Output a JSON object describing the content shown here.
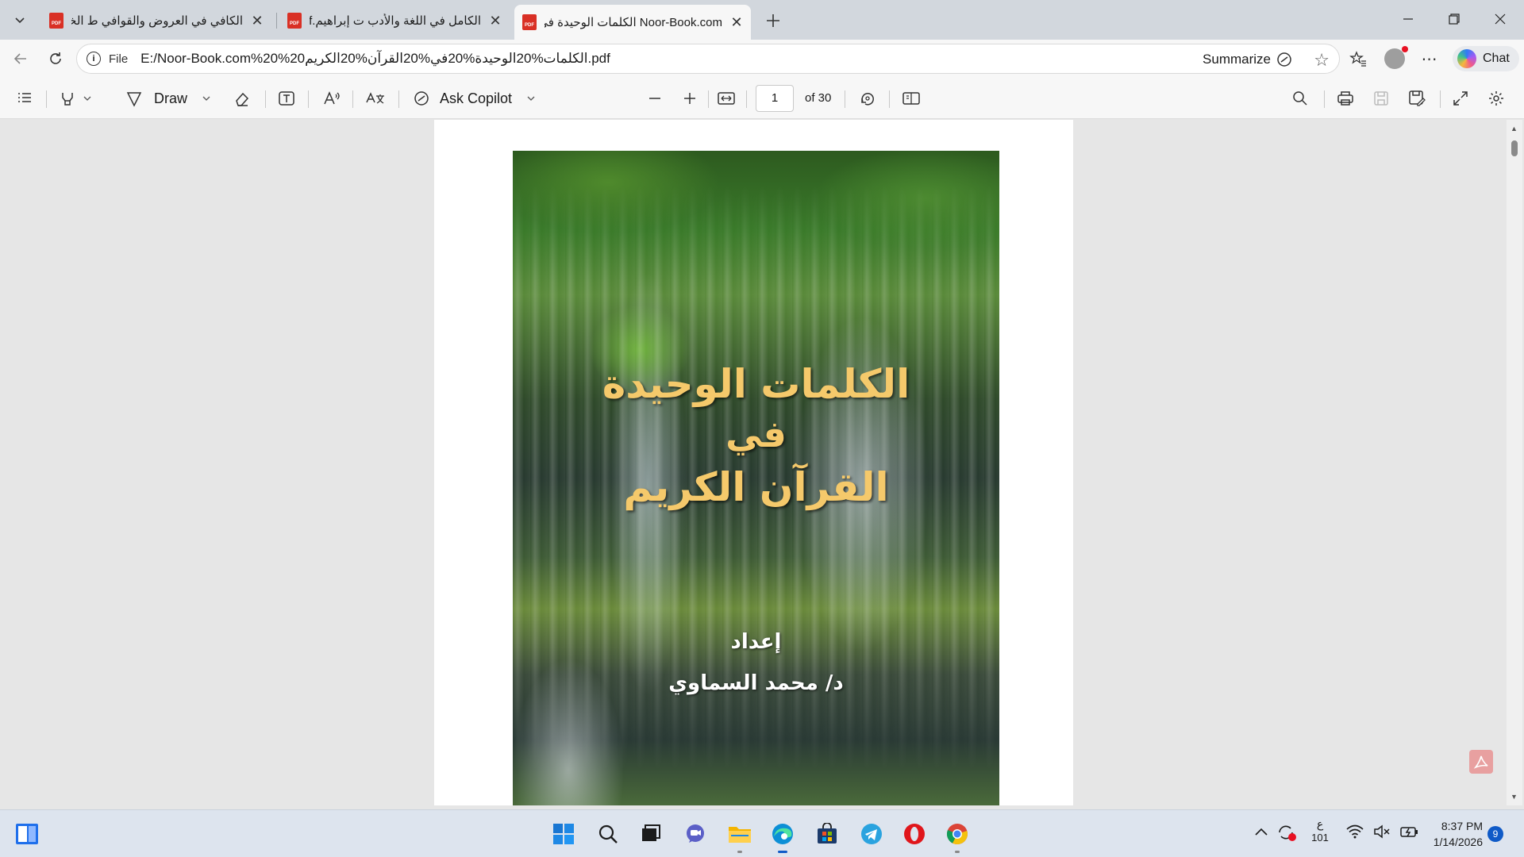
{
  "tabs": [
    {
      "title": "الكافي في العروض والقوافي ط الخانجي",
      "active": false
    },
    {
      "title": "الكامل في اللغة والأدب ت إبراهيم.pdf",
      "active": false
    },
    {
      "title": "Noor-Book.com الكلمات الوحيدة في القرآن الكريم",
      "active": true
    }
  ],
  "tab_close_glyph": "✕",
  "pdf_icon_label": "PDF",
  "address_bar": {
    "scheme_label": "File",
    "url": "E:/Noor-Book.com%20%20الكلمات%20الوحيدة%20في%20القرآن%20الكريم.pdf",
    "summarize_label": "Summarize"
  },
  "chat_label": "Chat",
  "pdf_toolbar": {
    "draw_label": "Draw",
    "ask_copilot_label": "Ask Copilot",
    "page_number": "1",
    "page_total_label": "of 30"
  },
  "cover": {
    "title_line1": "الكلمات الوحيدة",
    "title_line2": "في",
    "title_line3": "القرآن الكريم",
    "prepared_by_label": "إعداد",
    "author": "د/ محمد السماوي"
  },
  "taskbar": {
    "language_indicator": "ع",
    "language_sub": "101",
    "time": "8:37 PM",
    "date": "1/14/2026",
    "notification_count": "9"
  },
  "colors": {
    "accent": "#0f5ac7",
    "cover_title": "#f5c96b",
    "pdf_icon": "#d93025"
  }
}
